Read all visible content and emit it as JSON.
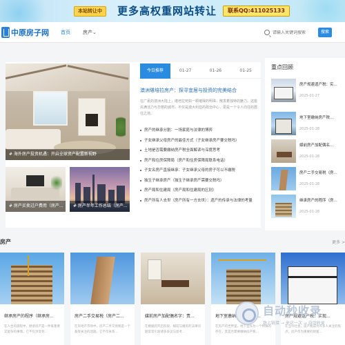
{
  "banner": {
    "tag": "本站转让中",
    "headline": "更多高权重网站转让",
    "contact": "联系QQ:411025133"
  },
  "header": {
    "logo_text": "中原房子网",
    "nav": [
      {
        "label": "首页",
        "active": true
      },
      {
        "label": "房产",
        "active": false,
        "has_dropdown": true
      }
    ],
    "search": {
      "placeholder": "请输入关键词搜索",
      "button": "搜索"
    }
  },
  "feature": {
    "hero_caption": "# 海外房产投资机遇：开启全球资产配置新视野",
    "thumbs": [
      {
        "caption": "# 房产买卖过户费用（房产..."
      },
      {
        "caption": "# 房产半年工作总结（房产..."
      }
    ]
  },
  "tabs": [
    {
      "label": "今日推荐",
      "active": true
    },
    {
      "label": "01-27",
      "active": false
    },
    {
      "label": "01-26",
      "active": false
    },
    {
      "label": "01-25",
      "active": false
    }
  ],
  "lead": {
    "title": "澳洲堪培拉房产：探寻宜居与投资的完美结合",
    "desc": "在广袤的澳洲大陆上，堪培拉宛如一颗璀璨的明珠，散发着独特的魅力。这座充满活力与华丽的城市，不仅是澳大利亚的政治中心，更是一个令人向往的居住之地。"
  },
  "articles": [
    "房产的继承分割：一场家庭与法律的博弈",
    "子女继承父母房产的最佳方式（子女继承房产要交税吗）",
    "土地是否需要缴纳房产税全面解读与深度思考",
    "房产和住房保障局（房产和住房保障局联系电话）",
    "子女名房产直接继承：子女继承父母的房子可以不缴税",
    "独生子继承房产（独生子继承房产需要交税吗）",
    "房产局和住建局（房产局和住建局的区别）",
    "房产所有人去世（房产所有一方去世）：遗产的传承与法律的考量"
  ],
  "sidebar": {
    "title": "重点回顾",
    "items": [
      {
        "title": "房产规避遗产税：实...",
        "date": "2025-01-27"
      },
      {
        "title": "地下室缴纳房产税...",
        "date": "2025-01-28"
      },
      {
        "title": "媒前房产加配偶名...",
        "date": "2025-01-28"
      },
      {
        "title": "房产二手交易税（房...",
        "date": "2025-01-28"
      },
      {
        "title": "继承房产的程序（房...",
        "date": "2025-01-28"
      }
    ]
  },
  "section": {
    "title": "房产",
    "more": "更多 >",
    "cards": [
      {
        "title": "继承房产的程序（继承房...",
        "desc": "在人生的旅程中，继承房产是一件既重要又复杂的事情。它不仅涉及到..."
      },
      {
        "title": "房产二手交易税（房产二...",
        "desc": "在房地产市场中，房产二手交易税是一个备受关注的话题。它不仅关系..."
      },
      {
        "title": "媒前房产加配偶名字：责...",
        "desc": "在婚姻的开启阶段，媒前与婚房的法律问题常常引发诸多争议与思考..."
      },
      {
        "title": "地下室缴纳房产税吗？...",
        "desc": "在房产的世界里，地下室作为一个特殊的存在，其是否需要缴纳房产税..."
      },
      {
        "title": "房产规避遗产税：实现...",
        "desc": "在当今社会，遗产税成为许多人关注的焦点，房产作为重要的财富..."
      }
    ]
  },
  "watermark": {
    "big": "自动秒收录",
    "small": "致上链接 → 来访一次 → 自动收录"
  }
}
